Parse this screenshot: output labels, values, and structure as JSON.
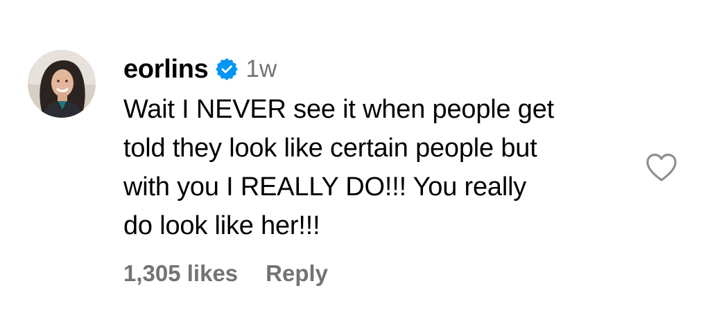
{
  "comment": {
    "username": "eorlins",
    "verified_icon": "verified-badge-icon",
    "time_ago": "1w",
    "lines": [
      "Wait I NEVER see it when people get",
      "told they look like certain people but",
      "with you I REALLY DO!!! You really",
      "do look like her!!!"
    ],
    "likes": "1,305 likes",
    "reply_label": "Reply",
    "like_icon": "heart-outline-icon",
    "avatar_icon": "profile-photo"
  },
  "colors": {
    "verified_blue": "#0095f6",
    "secondary_text": "#737373",
    "heart_stroke": "#8e8e8e"
  }
}
